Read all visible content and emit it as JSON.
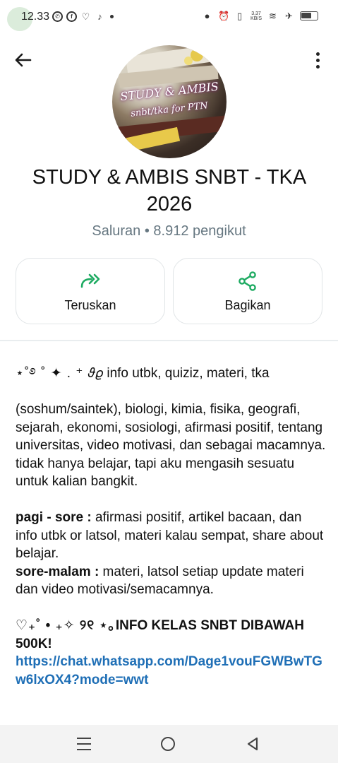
{
  "status_bar": {
    "time": "12.33",
    "net_speed": "3,37\nKB/S"
  },
  "channel": {
    "avatar_text_1": "STUDY & AMBIS",
    "avatar_text_2": "snbt/tka for PTN",
    "title": "STUDY & AMBIS SNBT - TKA 2026",
    "subtitle": "Saluran • 8.912 pengikut"
  },
  "actions": {
    "forward_label": "Teruskan",
    "share_label": "Bagikan"
  },
  "description": {
    "line1_deco": "⋆˚࿔ ˚  ✦   .  ⁺   ",
    "line1_text": "𝜗𝜚 info utbk, quiziz, materi, tka",
    "para1": "(soshum/saintek), biologi, kimia, fisika, geografi, sejarah, ekonomi, sosiologi, afirmasi positif, tentang universitas, video motivasi, dan sebagai macamnya. tidak hanya belajar, tapi aku mengasih sesuatu untuk kalian bangkit.",
    "pagi_label": "pagi - sore :",
    "pagi_text": " afirmasi positif, artikel bacaan, dan info utbk or latsol, materi kalau sempat, share about belajar.",
    "malam_label": "sore-malam :",
    "malam_text": " materi, latsol setiap update materi dan video motivasi/semacamnya.",
    "info_deco": "♡₊˚ • ₊✧ ୨୧ ⋆｡",
    "info_text": "INFO KELAS SNBT DIBAWAH 500K!",
    "link": "https://chat.whatsapp.com/Dage1vouFGWBwTGw6lxOX4?mode=wwt"
  },
  "colors": {
    "accent_green": "#1daa61",
    "link_blue": "#1f6fb6",
    "muted": "#667781"
  }
}
